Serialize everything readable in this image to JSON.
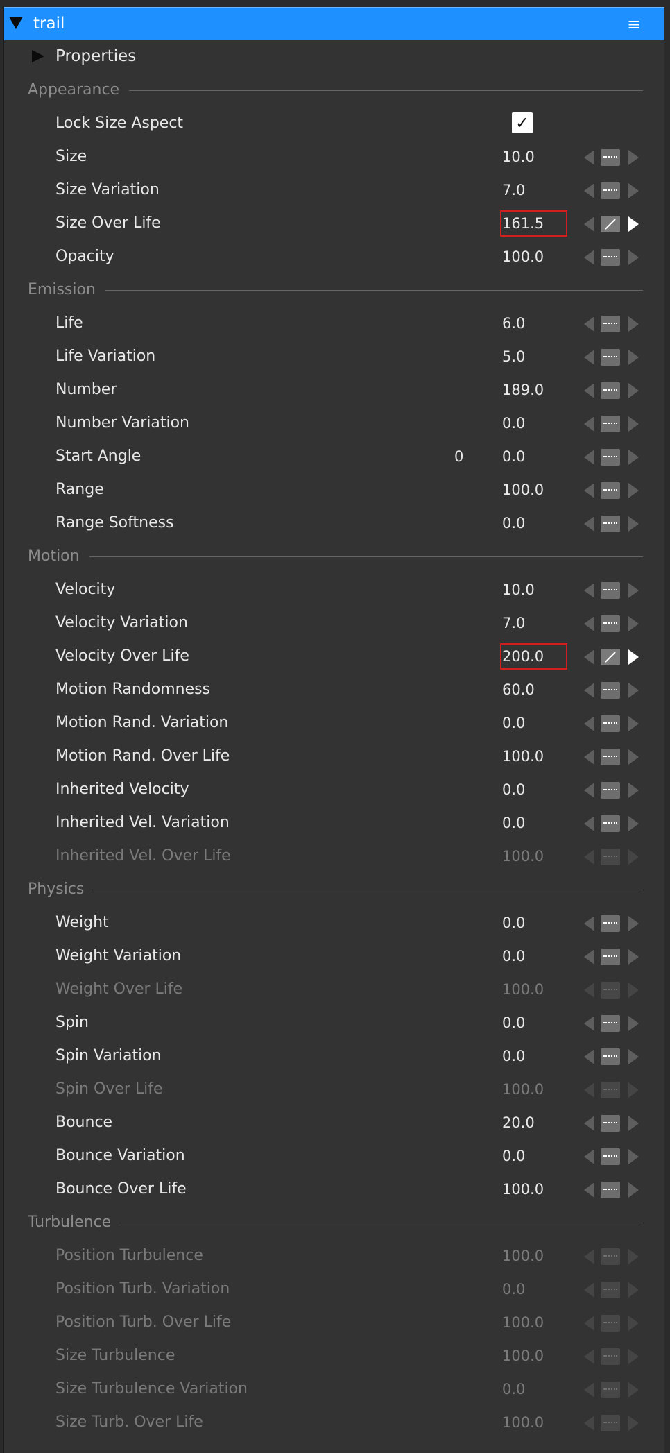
{
  "header": {
    "title": "trail",
    "menu_icon": "hamburger-menu-icon",
    "color": "#1e90ff"
  },
  "properties": {
    "label": "Properties"
  },
  "sections": [
    {
      "title": "Appearance",
      "rows": [
        {
          "label": "Lock Size Aspect",
          "checkbox": true,
          "check_glyph": "✓"
        },
        {
          "label": "Size",
          "value": "10.0"
        },
        {
          "label": "Size Variation",
          "value": "7.0"
        },
        {
          "label": "Size Over Life",
          "value": "161.5",
          "highlight": true,
          "curve": true
        },
        {
          "label": "Opacity",
          "value": "100.0"
        }
      ]
    },
    {
      "title": "Emission",
      "rows": [
        {
          "label": "Life",
          "value": "6.0"
        },
        {
          "label": "Life Variation",
          "value": "5.0"
        },
        {
          "label": "Number",
          "value": "189.0"
        },
        {
          "label": "Number Variation",
          "value": "0.0"
        },
        {
          "label": "Start Angle",
          "extra": "0",
          "value": "0.0"
        },
        {
          "label": "Range",
          "value": "100.0"
        },
        {
          "label": "Range Softness",
          "value": "0.0"
        }
      ]
    },
    {
      "title": "Motion",
      "rows": [
        {
          "label": "Velocity",
          "value": "10.0"
        },
        {
          "label": "Velocity Variation",
          "value": "7.0"
        },
        {
          "label": "Velocity Over Life",
          "value": "200.0",
          "highlight": true,
          "curve": true
        },
        {
          "label": "Motion Randomness",
          "value": "60.0"
        },
        {
          "label": "Motion Rand. Variation",
          "value": "0.0"
        },
        {
          "label": "Motion Rand. Over Life",
          "value": "100.0"
        },
        {
          "label": "Inherited Velocity",
          "value": "0.0"
        },
        {
          "label": "Inherited Vel. Variation",
          "value": "0.0"
        },
        {
          "label": "Inherited Vel. Over Life",
          "value": "100.0",
          "disabled": true
        }
      ]
    },
    {
      "title": "Physics",
      "rows": [
        {
          "label": "Weight",
          "value": "0.0"
        },
        {
          "label": "Weight Variation",
          "value": "0.0"
        },
        {
          "label": "Weight Over Life",
          "value": "100.0",
          "disabled": true
        },
        {
          "label": "Spin",
          "value": "0.0"
        },
        {
          "label": "Spin Variation",
          "value": "0.0"
        },
        {
          "label": "Spin Over Life",
          "value": "100.0",
          "disabled": true
        },
        {
          "label": "Bounce",
          "value": "20.0"
        },
        {
          "label": "Bounce Variation",
          "value": "0.0"
        },
        {
          "label": "Bounce Over Life",
          "value": "100.0"
        }
      ]
    },
    {
      "title": "Turbulence",
      "rows": [
        {
          "label": "Position Turbulence",
          "value": "100.0",
          "disabled": true
        },
        {
          "label": "Position Turb. Variation",
          "value": "0.0",
          "disabled": true
        },
        {
          "label": "Position Turb. Over Life",
          "value": "100.0",
          "disabled": true
        },
        {
          "label": "Size Turbulence",
          "value": "100.0",
          "disabled": true
        },
        {
          "label": "Size Turbulence Variation",
          "value": "0.0",
          "disabled": true
        },
        {
          "label": "Size Turb. Over Life",
          "value": "100.0",
          "disabled": true
        }
      ]
    }
  ]
}
